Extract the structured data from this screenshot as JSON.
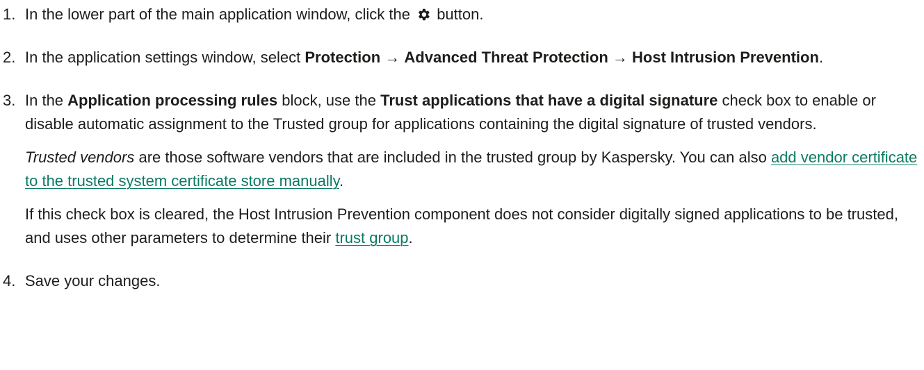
{
  "steps": [
    {
      "number": "1.",
      "before_icon": "In the lower part of the main application window, click the ",
      "icon": "gear-icon",
      "after_icon": " button."
    },
    {
      "number": "2.",
      "text_before": "In the application settings window, select ",
      "path_1": "Protection",
      "arrow_1": " → ",
      "path_2": "Advanced Threat Protection",
      "arrow_2": " → ",
      "path_3": "Host Intrusion Prevention",
      "text_after": "."
    },
    {
      "number": "3.",
      "t1": "In the ",
      "block_name": "Application processing rules",
      "t2": " block, use the ",
      "checkbox_name": "Trust applications that have a digital signature",
      "t3": " check box to enable or disable automatic assignment to the Trusted group for applications containing the digital signature of trusted vendors.",
      "p2_term": "Trusted vendors",
      "p2_text": " are those software vendors that are included in the trusted group by Kaspersky. You can also ",
      "p2_link": "add vendor certificate to the trusted system certificate store manually",
      "p2_end": ".",
      "p3_text": "If this check box is cleared, the Host Intrusion Prevention component does not consider digitally signed applications to be trusted, and uses other parameters to determine their ",
      "p3_link": "trust group",
      "p3_end": "."
    },
    {
      "number": "4.",
      "text": "Save your changes."
    }
  ],
  "colors": {
    "text": "#1d1d1b",
    "link": "#0a7a63"
  }
}
